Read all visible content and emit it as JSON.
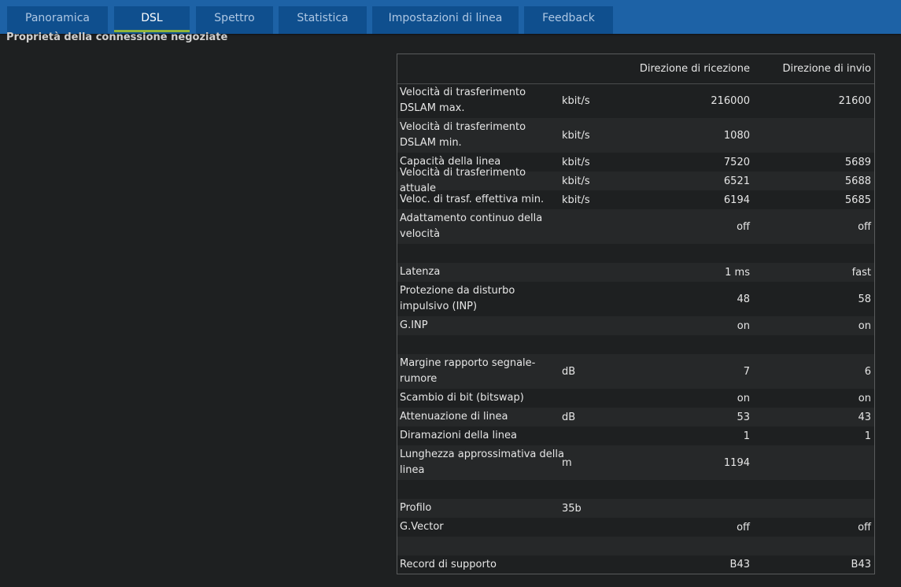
{
  "tabs": [
    {
      "label": "Panoramica"
    },
    {
      "label": "DSL"
    },
    {
      "label": "Spettro"
    },
    {
      "label": "Statistica"
    },
    {
      "label": "Impostazioni di linea"
    },
    {
      "label": "Feedback"
    }
  ],
  "active_tab": "DSL",
  "accent_color": "#8fb53a",
  "header_color": "#1d62a6",
  "section_title": "Proprietà della connessione negoziate",
  "table": {
    "headers": {
      "rx": "Direzione di ricezione",
      "tx": "Direzione di invio"
    },
    "rows": [
      {
        "label": "Velocità di trasferimento DSLAM max.",
        "unit": "kbit/s",
        "rx": "216000",
        "tx": "21600"
      },
      {
        "label": "Velocità di trasferimento DSLAM min.",
        "unit": "kbit/s",
        "rx": "1080",
        "tx": ""
      },
      {
        "label": "Capacità della linea",
        "unit": "kbit/s",
        "rx": "7520",
        "tx": "5689"
      },
      {
        "label": "Velocità di trasferimento attuale",
        "unit": "kbit/s",
        "rx": "6521",
        "tx": "5688"
      },
      {
        "label": "Veloc. di trasf. effettiva min.",
        "unit": "kbit/s",
        "rx": "6194",
        "tx": "5685"
      },
      {
        "label": "Adattamento continuo della velocità",
        "unit": "",
        "rx": "off",
        "tx": "off"
      },
      {
        "label": "",
        "unit": "",
        "rx": "",
        "tx": ""
      },
      {
        "label": "Latenza",
        "unit": "",
        "rx": "1 ms",
        "tx": "fast"
      },
      {
        "label": "Protezione da disturbo impulsivo (INP)",
        "unit": "",
        "rx": "48",
        "tx": "58"
      },
      {
        "label": "G.INP",
        "unit": "",
        "rx": "on",
        "tx": "on"
      },
      {
        "label": "",
        "unit": "",
        "rx": "",
        "tx": ""
      },
      {
        "label": "Margine rapporto segnale-rumore",
        "unit": "dB",
        "rx": "7",
        "tx": "6"
      },
      {
        "label": "Scambio di bit (bitswap)",
        "unit": "",
        "rx": "on",
        "tx": "on"
      },
      {
        "label": "Attenuazione di linea",
        "unit": "dB",
        "rx": "53",
        "tx": "43"
      },
      {
        "label": "Diramazioni della linea",
        "unit": "",
        "rx": "1",
        "tx": "1"
      },
      {
        "label": "Lunghezza approssimativa della linea",
        "unit": "m",
        "rx": "1194",
        "tx": ""
      },
      {
        "label": "",
        "unit": "",
        "rx": "",
        "tx": ""
      },
      {
        "label": "Profilo",
        "unit": "35b",
        "rx": "",
        "tx": ""
      },
      {
        "label": "G.Vector",
        "unit": "",
        "rx": "off",
        "tx": "off"
      },
      {
        "label": "",
        "unit": "",
        "rx": "",
        "tx": ""
      },
      {
        "label": "Record di supporto",
        "unit": "",
        "rx": "B43",
        "tx": "B43"
      }
    ]
  }
}
